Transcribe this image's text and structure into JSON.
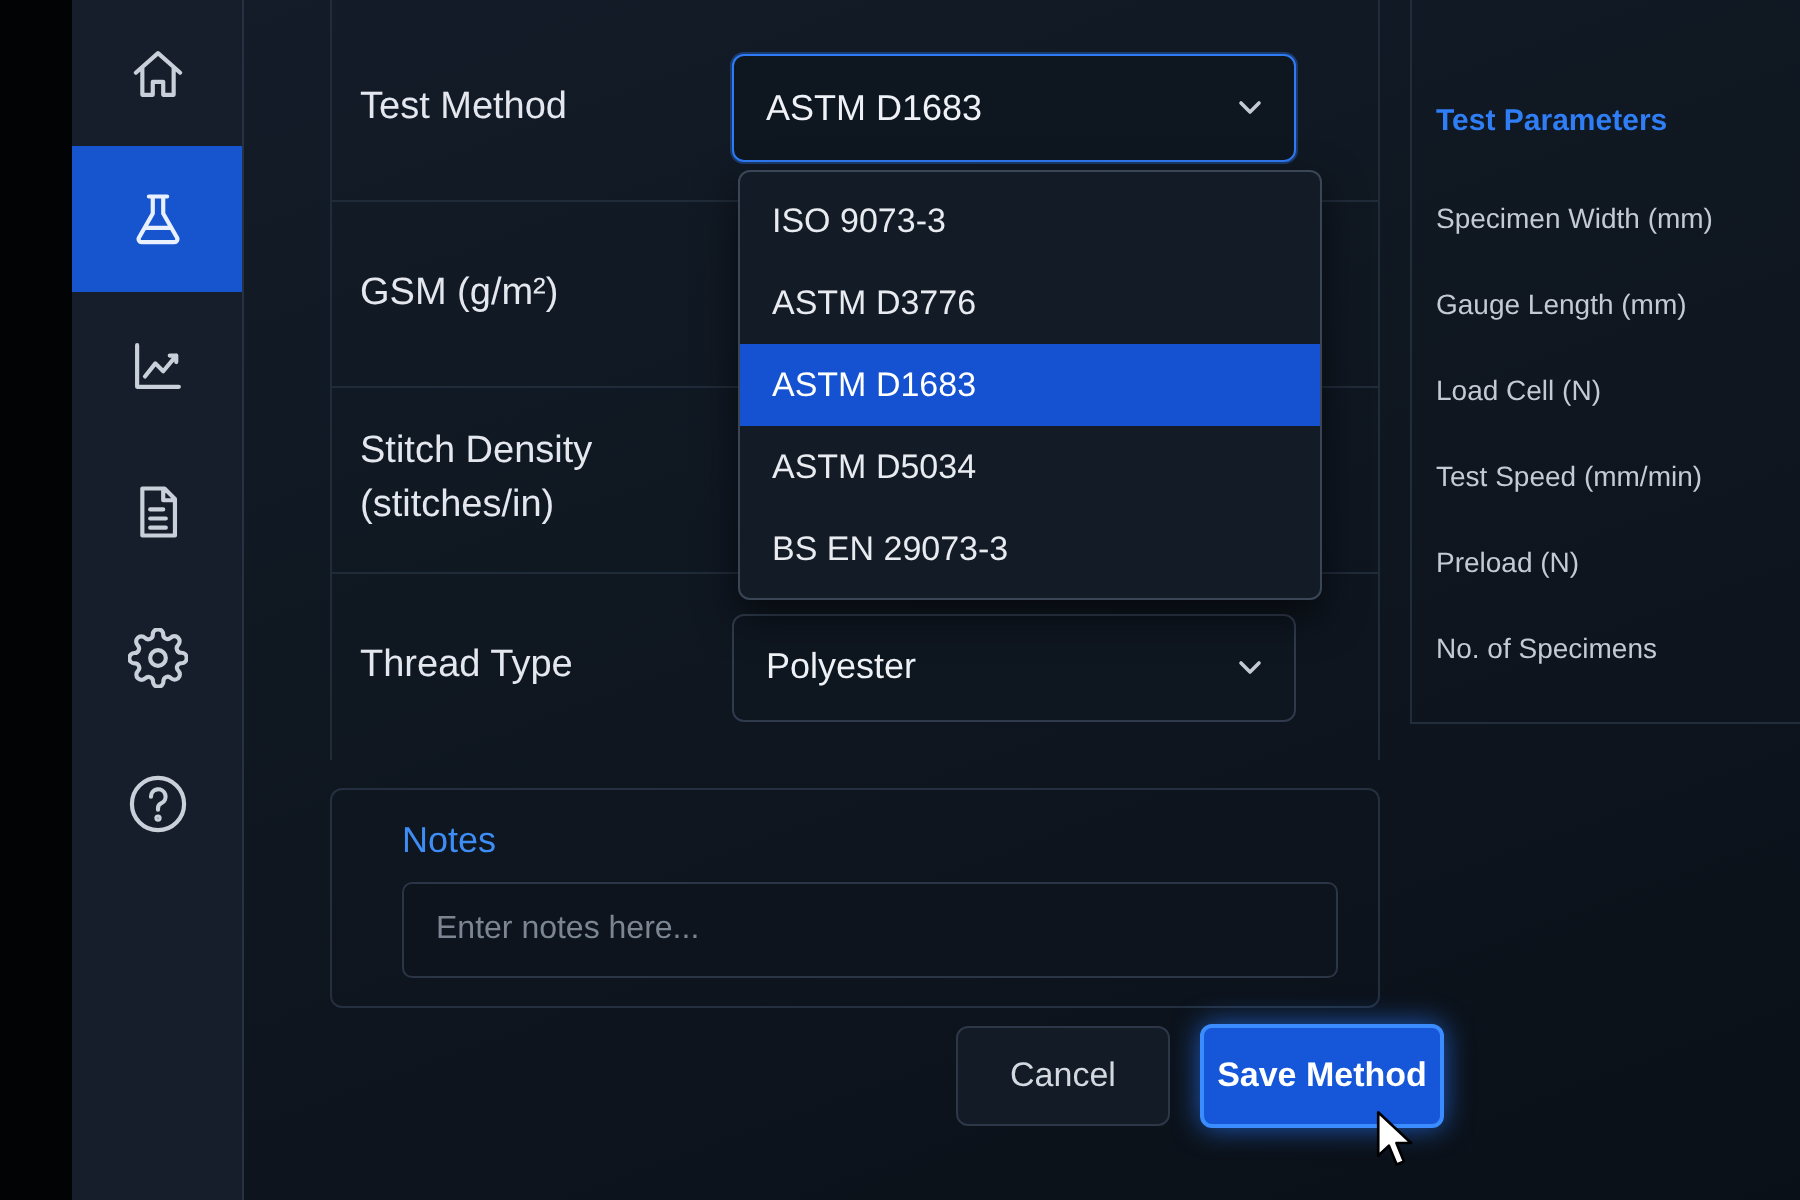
{
  "sidebar": {
    "items": [
      {
        "kind": "home",
        "selected": false
      },
      {
        "kind": "flask",
        "selected": true
      },
      {
        "kind": "chart",
        "selected": false
      },
      {
        "kind": "document",
        "selected": false
      },
      {
        "kind": "settings",
        "selected": false
      },
      {
        "kind": "help",
        "selected": false
      }
    ]
  },
  "form": {
    "fields": [
      {
        "label": "Test Method",
        "kind": "select",
        "value": "ASTM D1683",
        "expanded": true,
        "options": [
          {
            "label": "ISO 9073-3",
            "selected": false
          },
          {
            "label": "ASTM D3776",
            "selected": false
          },
          {
            "label": "ASTM D1683",
            "selected": true
          },
          {
            "label": "ASTM D5034",
            "selected": false
          },
          {
            "label": "BS EN 29073-3",
            "selected": false
          }
        ]
      },
      {
        "label": "GSM (g/m²)",
        "kind": "covered"
      },
      {
        "label": "Stitch Density (stitches/in)",
        "kind": "covered"
      },
      {
        "label": "Thread Type",
        "kind": "select",
        "value": "Polyester",
        "expanded": false
      }
    ]
  },
  "test_parameters": {
    "title": "Test Parameters",
    "items": [
      "Specimen Width (mm)",
      "Gauge Length (mm)",
      "Load Cell (N)",
      "Test Speed (mm/min)",
      "Preload (N)",
      "No. of Specimens"
    ]
  },
  "notes": {
    "label": "Notes",
    "placeholder": "Enter notes here..."
  },
  "buttons": [
    {
      "label": "Cancel",
      "kind": "secondary",
      "hovered": false
    },
    {
      "label": "Save Method",
      "kind": "primary",
      "hovered": true
    }
  ]
}
